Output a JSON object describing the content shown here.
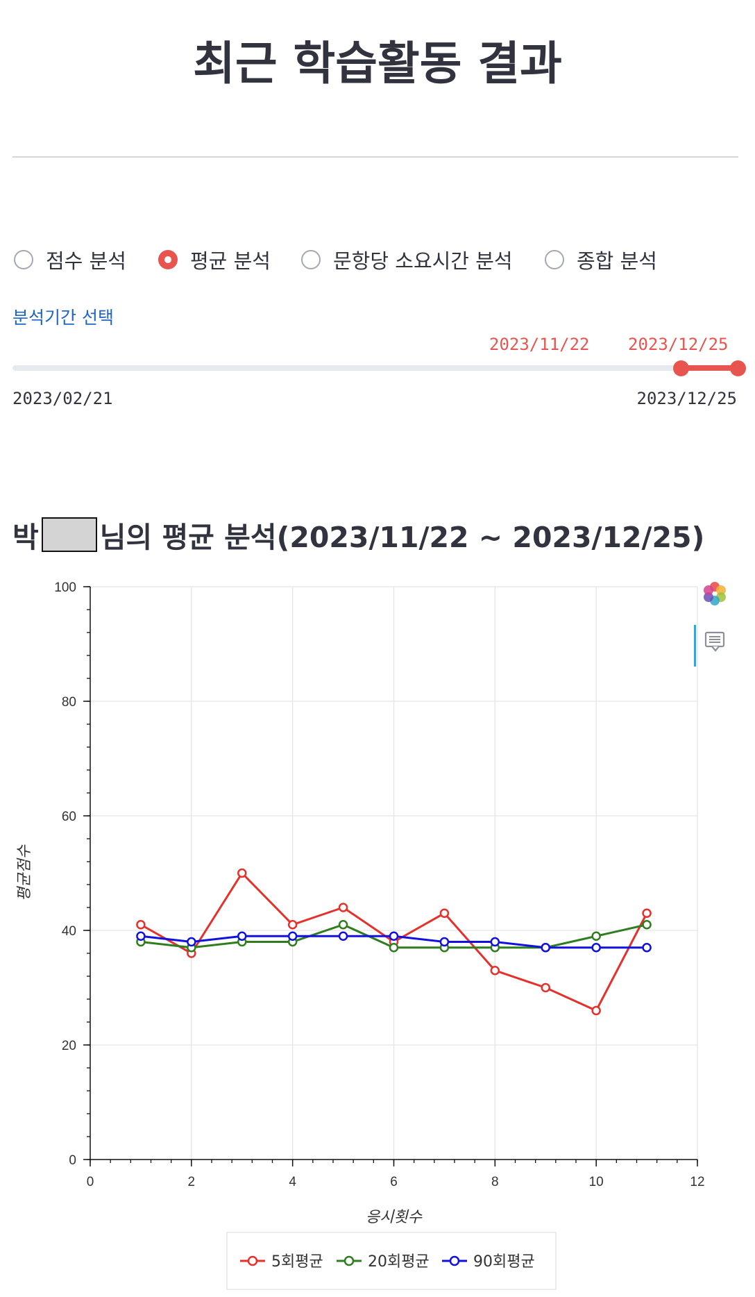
{
  "page": {
    "title": "최근 학습활동 결과"
  },
  "analysis_modes": {
    "options": [
      {
        "label": "점수 분석",
        "selected": false
      },
      {
        "label": "평균 분석",
        "selected": true
      },
      {
        "label": "문항당 소요시간 분석",
        "selected": false
      },
      {
        "label": "종합 분석",
        "selected": false
      }
    ]
  },
  "period": {
    "label": "분석기간 선택",
    "selected_start": "2023/11/22",
    "selected_end": "2023/12/25",
    "min": "2023/02/21",
    "max": "2023/12/25"
  },
  "chart_heading": {
    "prefix": "박",
    "suffix": " 님의 평균 분석(2023/11/22 ~ 2023/12/25)"
  },
  "toolbar": {
    "logo_icon": "bokeh-logo-icon",
    "hover_icon": "hover-tool-icon"
  },
  "chart_data": {
    "type": "line",
    "xlabel": "응시횟수",
    "ylabel": "평균점수",
    "xlim": [
      0,
      12
    ],
    "ylim": [
      0,
      100
    ],
    "xticks": [
      0,
      2,
      4,
      6,
      8,
      10,
      12
    ],
    "yticks": [
      0,
      20,
      40,
      60,
      80,
      100
    ],
    "grid": true,
    "legend_position": "bottom",
    "x": [
      1,
      2,
      3,
      4,
      5,
      6,
      7,
      8,
      9,
      10,
      11
    ],
    "series": [
      {
        "name": "5회평균",
        "color": "#e5302c",
        "values": [
          41,
          36,
          50,
          41,
          44,
          38,
          43,
          33,
          30,
          26,
          43
        ]
      },
      {
        "name": "20회평균",
        "color": "#2e7d1e",
        "values": [
          38,
          37,
          38,
          38,
          41,
          37,
          37,
          37,
          37,
          39,
          41
        ]
      },
      {
        "name": "90회평균",
        "color": "#1010e0",
        "values": [
          39,
          38,
          39,
          39,
          39,
          39,
          38,
          38,
          37,
          37,
          37
        ]
      }
    ]
  }
}
